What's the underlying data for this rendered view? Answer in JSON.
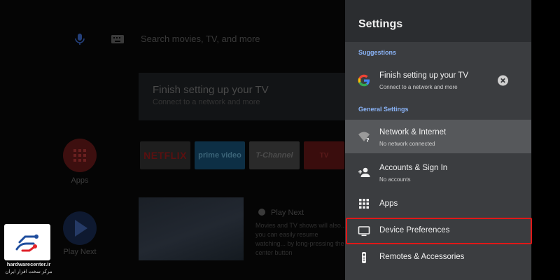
{
  "home": {
    "search_placeholder": "Search movies, TV, and more",
    "banner": {
      "title": "Finish setting up your TV",
      "subtitle": "Connect to a network and more"
    },
    "rail": [
      {
        "label": "Apps"
      },
      {
        "label": "Play Next"
      }
    ],
    "channel_tiles": [
      "NETFLIX",
      "prime video",
      "T-Channel",
      "TV"
    ],
    "play_next": {
      "title": "Play Next",
      "description": "Movies and TV shows will also... you can easily resume watching... by long-pressing the center button"
    }
  },
  "settings": {
    "title": "Settings",
    "suggestions_label": "Suggestions",
    "suggestion": {
      "title": "Finish setting up your TV",
      "subtitle": "Connect to a network and more",
      "icon": "google-g-icon"
    },
    "general_label": "General Settings",
    "items": [
      {
        "title": "Network & Internet",
        "subtitle": "No network connected",
        "icon": "wifi-question-icon",
        "active": true
      },
      {
        "title": "Accounts & Sign In",
        "subtitle": "No accounts",
        "icon": "add-person-icon"
      },
      {
        "title": "Apps",
        "subtitle": "",
        "icon": "apps-grid-icon"
      },
      {
        "title": "Device Preferences",
        "subtitle": "",
        "icon": "tv-monitor-icon",
        "highlighted": true
      },
      {
        "title": "Remotes & Accessories",
        "subtitle": "",
        "icon": "remote-icon"
      }
    ]
  },
  "colors": {
    "panel_bg": "#3b3d40",
    "panel_header_bg": "#2b2d30",
    "active_row_bg": "#56585b",
    "section_label": "#8ab4f8",
    "highlight_border": "#e01818"
  },
  "watermark": {
    "url": "hardwarecenter.ir",
    "tagline": "مرکز سخت افزار ایران"
  }
}
